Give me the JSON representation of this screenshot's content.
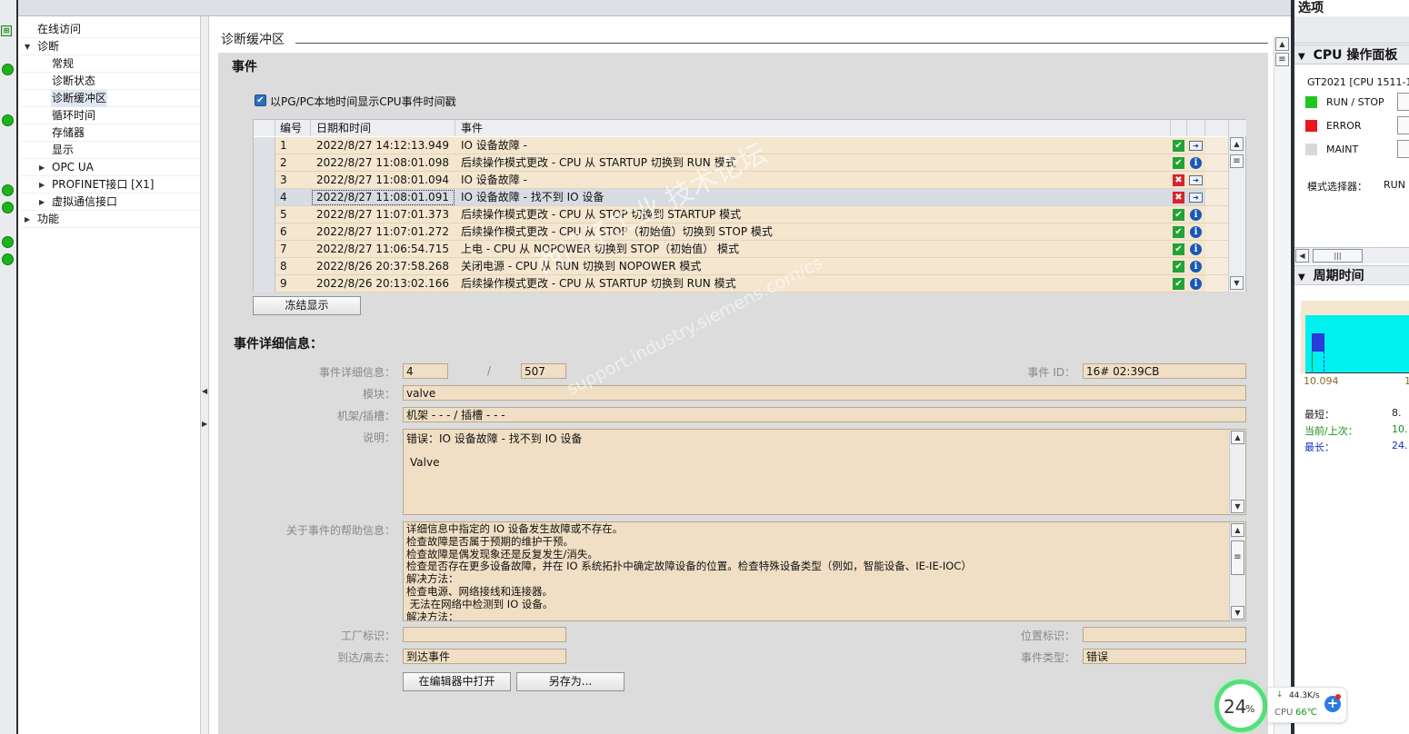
{
  "nav": {
    "items": [
      {
        "label": "在线访问",
        "level": 0,
        "arrow": ""
      },
      {
        "label": "诊断",
        "level": 0,
        "arrow": "down"
      },
      {
        "label": "常规",
        "level": 1,
        "arrow": ""
      },
      {
        "label": "诊断状态",
        "level": 1,
        "arrow": ""
      },
      {
        "label": "诊断缓冲区",
        "level": 1,
        "arrow": "",
        "selected": true
      },
      {
        "label": "循环时间",
        "level": 1,
        "arrow": ""
      },
      {
        "label": "存储器",
        "level": 1,
        "arrow": ""
      },
      {
        "label": "显示",
        "level": 1,
        "arrow": ""
      },
      {
        "label": "OPC UA",
        "level": 1,
        "arrow": "right"
      },
      {
        "label": "PROFINET接口 [X1]",
        "level": 1,
        "arrow": "right"
      },
      {
        "label": "虚拟通信接口",
        "level": 1,
        "arrow": "right"
      },
      {
        "label": "功能",
        "level": 0,
        "arrow": "right"
      }
    ]
  },
  "tab_title": "诊断缓冲区",
  "events_section": {
    "title": "事件",
    "checkbox_label": "以PG/PC本地时间显示CPU事件时间戳",
    "columns": [
      "编号",
      "日期和时间",
      "事件"
    ],
    "rows": [
      {
        "no": "1",
        "datetime": "2022/8/27 14:12:13.949",
        "event": "IO 设备故障 -",
        "status": "ok",
        "icon": "envelope"
      },
      {
        "no": "2",
        "datetime": "2022/8/27 11:08:01.098",
        "event": "后续操作模式更改 - CPU 从 STARTUP 切换到 RUN 模式",
        "status": "ok",
        "icon": "info"
      },
      {
        "no": "3",
        "datetime": "2022/8/27 11:08:01.094",
        "event": "IO 设备故障 -",
        "status": "error",
        "icon": "envelope"
      },
      {
        "no": "4",
        "datetime": "2022/8/27 11:08:01.091",
        "event": "IO 设备故障 - 找不到 IO 设备",
        "status": "error",
        "icon": "envelope",
        "selected": true
      },
      {
        "no": "5",
        "datetime": "2022/8/27 11:07:01.373",
        "event": "后续操作模式更改 - CPU 从 STOP 切换到 STARTUP 模式",
        "status": "ok",
        "icon": "info"
      },
      {
        "no": "6",
        "datetime": "2022/8/27 11:07:01.272",
        "event": "后续操作模式更改 - CPU 从 STOP（初始值）切换到 STOP 模式",
        "status": "ok",
        "icon": "info"
      },
      {
        "no": "7",
        "datetime": "2022/8/27 11:06:54.715",
        "event": "上电 - CPU 从 NOPOWER 切换到 STOP（初始值） 模式",
        "status": "ok",
        "icon": "info"
      },
      {
        "no": "8",
        "datetime": "2022/8/26 20:37:58.268",
        "event": "关闭电源 - CPU 从 RUN 切换到 NOPOWER 模式",
        "status": "ok",
        "icon": "info"
      },
      {
        "no": "9",
        "datetime": "2022/8/26 20:13:02.166",
        "event": "后续操作模式更改 - CPU 从 STARTUP 切换到 RUN 模式",
        "status": "ok",
        "icon": "info"
      }
    ],
    "freeze_button": "冻结显示"
  },
  "details": {
    "title": "事件详细信息：",
    "detail_label": "事件详细信息：",
    "detail_value1": "4",
    "detail_sep": "/",
    "detail_value2": "507",
    "event_id_label": "事件 ID：",
    "event_id_value": "16# 02:39CB",
    "module_label": "模块：",
    "module_value": "valve",
    "rack_label": "机架/插槽：",
    "rack_value": "机架 - - - / 插槽 - - -",
    "desc_label": "说明：",
    "desc_line1": "错误：IO 设备故障 - 找不到 IO 设备",
    "desc_line2": "Valve",
    "help_label": "关于事件的帮助信息：",
    "help_lines": [
      "详细信息中指定的 IO 设备发生故障或不存在。",
      "检查故障是否属于预期的维护干预。",
      "检查故障是偶发现象还是反复发生/消失。",
      "检查是否存在更多设备故障，并在 IO 系统拓扑中确定故障设备的位置。检查特殊设备类型（例如，智能设备、IE-IE-IOC）",
      "解决方法：",
      "检查电源、网络接线和连接器。",
      " 无法在网络中检测到 IO 设备。",
      "解决方法："
    ],
    "plant_label": "工厂标识：",
    "plant_value": "",
    "location_label": "位置标识：",
    "location_value": "",
    "arrive_label": "到达/离去：",
    "arrive_value": "到达事件",
    "type_label": "事件类型：",
    "type_value": "错误",
    "open_editor_button": "在编辑器中打开",
    "save_as_button": "另存为..."
  },
  "watermark": {
    "line1": "西门子工业 技术论坛",
    "line2": "support.industry.siemens.com/cs"
  },
  "right": {
    "title": "选项",
    "cpu_panel_title": "CPU 操作面板",
    "device": "GT2021 [CPU 1511-1",
    "leds": [
      {
        "label": "RUN / STOP",
        "color": "#1ec51e"
      },
      {
        "label": "ERROR",
        "color": "#e8161f"
      },
      {
        "label": "MAINT",
        "color": "#d8d8d8"
      }
    ],
    "mode_label": "模式选择器：",
    "mode_value": "RUN",
    "cycle_title": "周期时间",
    "cycle_axis_left": "10.094",
    "cycle_axis_right": "1",
    "stats": [
      {
        "label": "最短：",
        "value": "8.",
        "color": "#222"
      },
      {
        "label": "当前/上次：",
        "value": "10.",
        "color": "#1a8f1a"
      },
      {
        "label": "最长：",
        "value": "24.",
        "color": "#1a2fc0"
      }
    ]
  },
  "widget": {
    "percent": "24",
    "percent_unit": "%",
    "speed": "44.3K/s",
    "cpu_label": "CPU",
    "cpu_temp": "66℃"
  }
}
